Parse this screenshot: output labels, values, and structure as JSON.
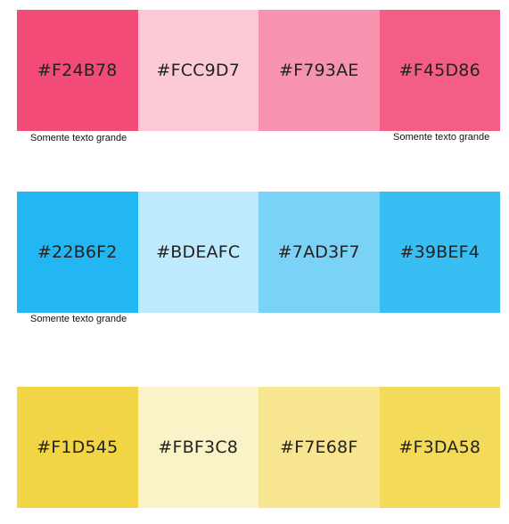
{
  "palette": {
    "rows": [
      {
        "swatches": [
          {
            "hex": "#F24B78",
            "color": "#F24B78"
          },
          {
            "hex": "#FCC9D7",
            "color": "#FCC9D7"
          },
          {
            "hex": "#F793AE",
            "color": "#F793AE"
          },
          {
            "hex": "#F45D86",
            "color": "#F45D86"
          }
        ]
      },
      {
        "swatches": [
          {
            "hex": "#22B6F2",
            "color": "#22B6F2"
          },
          {
            "hex": "#BDEAFC",
            "color": "#BDEAFC"
          },
          {
            "hex": "#7AD3F7",
            "color": "#7AD3F7"
          },
          {
            "hex": "#39BEF4",
            "color": "#39BEF4"
          }
        ]
      },
      {
        "swatches": [
          {
            "hex": "#F1D545",
            "color": "#F1D545"
          },
          {
            "hex": "#FBF3C8",
            "color": "#FBF3C8"
          },
          {
            "hex": "#F7E68F",
            "color": "#F7E68F"
          },
          {
            "hex": "#F3DA58",
            "color": "#F3DA58"
          }
        ]
      }
    ],
    "notes": {
      "row1_first": "Somente texto grande",
      "row1_last": "Somente texto grande",
      "row2_first": "Somente texto grande"
    }
  }
}
